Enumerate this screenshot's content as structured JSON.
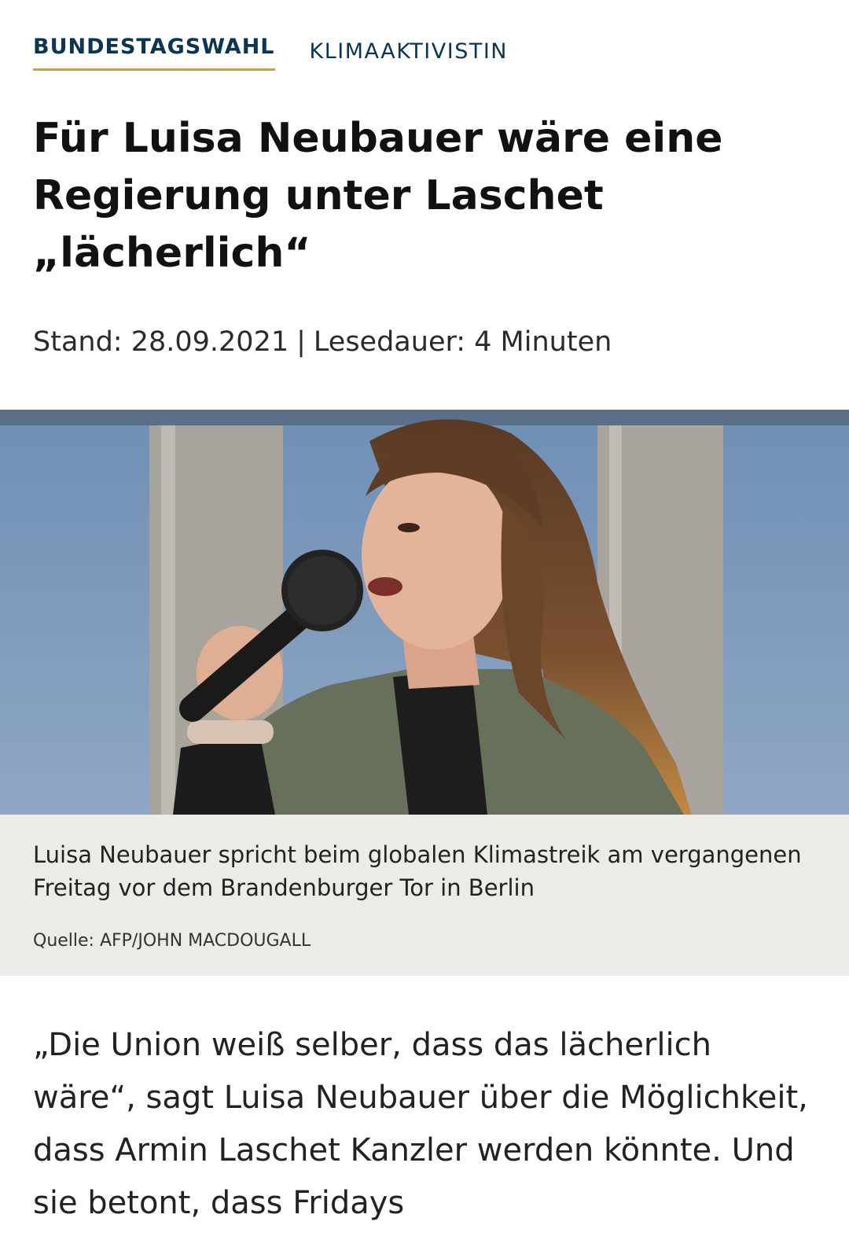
{
  "tags": {
    "primary": "BUNDESTAGSWAHL",
    "secondary": "KLIMAAKTIVISTIN"
  },
  "article": {
    "headline": "Für Luisa Neubauer wäre eine Regierung unter Laschet „lächerlich“",
    "meta": {
      "stand": "Stand: 28.09.2021",
      "separator": "|",
      "lesedauer": "Lesedauer: 4 Minuten"
    },
    "image": {
      "caption": "Luisa Neubauer spricht beim globalen Klimastreik am vergangenen Freitag vor dem Brandenburger Tor in Berlin",
      "source": "Quelle: AFP/JOHN MACDOUGALL"
    },
    "lead": "„Die Union weiß selber, dass das lächerlich wäre“, sagt Luisa Neubauer über die Möglichkeit, dass Armin Laschet Kanzler werden könnte. Und sie betont, dass Fridays"
  },
  "colors": {
    "tag_text": "#0b3551",
    "tag_underline": "#c9a24a",
    "caption_bg": "#ecebe8"
  }
}
